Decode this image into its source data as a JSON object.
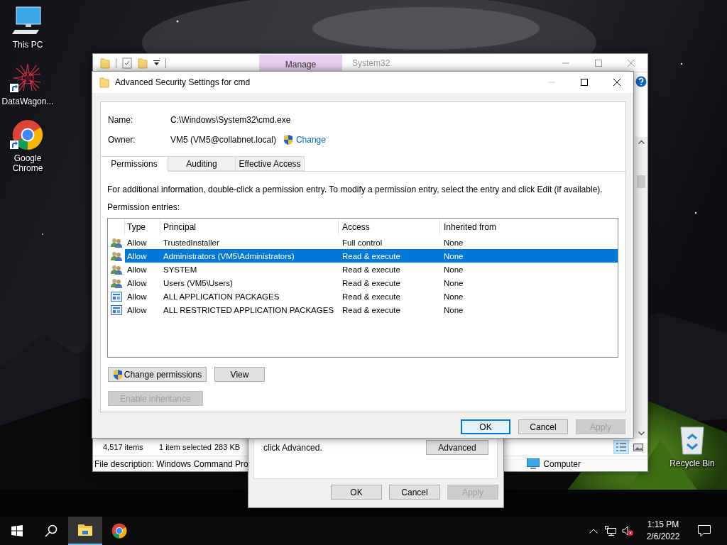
{
  "desktop_icons": [
    {
      "label": "This PC",
      "kind": "computer",
      "shortcut": false
    },
    {
      "label": "DataWagon...",
      "kind": "starburst",
      "shortcut": true
    },
    {
      "label": "Google Chrome",
      "kind": "chrome",
      "shortcut": true
    },
    {
      "label": "Recycle Bin",
      "kind": "recycle",
      "shortcut": false
    }
  ],
  "explorer": {
    "ribbon_tab": "Manage",
    "title": "System32",
    "status_bar": {
      "item_count": "4,517 items",
      "selection": "1 item selected",
      "size": "283 KB"
    },
    "details_pane": {
      "description": "File description: Windows Command Pro",
      "location": "Computer"
    }
  },
  "properties_dialog": {
    "text": "click Advanced.",
    "advanced_button": "Advanced",
    "buttons": [
      {
        "label": "OK",
        "disabled": false
      },
      {
        "label": "Cancel",
        "disabled": false
      },
      {
        "label": "Apply",
        "disabled": true
      }
    ]
  },
  "security_dialog": {
    "title": "Advanced Security Settings for cmd",
    "name_label": "Name:",
    "name_value": "C:\\Windows\\System32\\cmd.exe",
    "owner_label": "Owner:",
    "owner_value": "VM5 (VM5@collabnet.local)",
    "change_link": "Change",
    "tabs": [
      {
        "label": "Permissions",
        "selected": true
      },
      {
        "label": "Auditing",
        "selected": false
      },
      {
        "label": "Effective Access",
        "selected": false
      }
    ],
    "info": "For additional information, double-click a permission entry. To modify a permission entry, select the entry and click Edit (if available).",
    "entries_label": "Permission entries:",
    "columns": [
      "Type",
      "Principal",
      "Access",
      "Inherited from"
    ],
    "rows": [
      {
        "kind": "user",
        "type": "Allow",
        "principal": "TrustedInstaller",
        "access": "Full control",
        "inherited_from": "None",
        "selected": false
      },
      {
        "kind": "user",
        "type": "Allow",
        "principal": "Administrators (VM5\\Administrators)",
        "access": "Read & execute",
        "inherited_from": "None",
        "selected": true
      },
      {
        "kind": "user",
        "type": "Allow",
        "principal": "SYSTEM",
        "access": "Read & execute",
        "inherited_from": "None",
        "selected": false
      },
      {
        "kind": "user",
        "type": "Allow",
        "principal": "Users (VM5\\Users)",
        "access": "Read & execute",
        "inherited_from": "None",
        "selected": false
      },
      {
        "kind": "package",
        "type": "Allow",
        "principal": "ALL APPLICATION PACKAGES",
        "access": "Read & execute",
        "inherited_from": "None",
        "selected": false
      },
      {
        "kind": "package",
        "type": "Allow",
        "principal": "ALL RESTRICTED APPLICATION PACKAGES",
        "access": "Read & execute",
        "inherited_from": "None",
        "selected": false
      }
    ],
    "action_buttons": [
      {
        "label": "Change permissions",
        "shield": true,
        "disabled": false
      },
      {
        "label": "View",
        "shield": false,
        "disabled": false
      }
    ],
    "inheritance_button": {
      "label": "Enable inheritance",
      "disabled": true
    },
    "buttons": [
      {
        "label": "OK",
        "disabled": false,
        "focused": true
      },
      {
        "label": "Cancel",
        "disabled": false,
        "focused": false
      },
      {
        "label": "Apply",
        "disabled": true,
        "focused": false
      }
    ]
  },
  "taskbar": {
    "apps": [
      {
        "kind": "explorer",
        "active": true
      },
      {
        "kind": "chrome",
        "active": false
      }
    ],
    "clock": {
      "time": "1:15 PM",
      "date": "2/6/2022"
    }
  }
}
